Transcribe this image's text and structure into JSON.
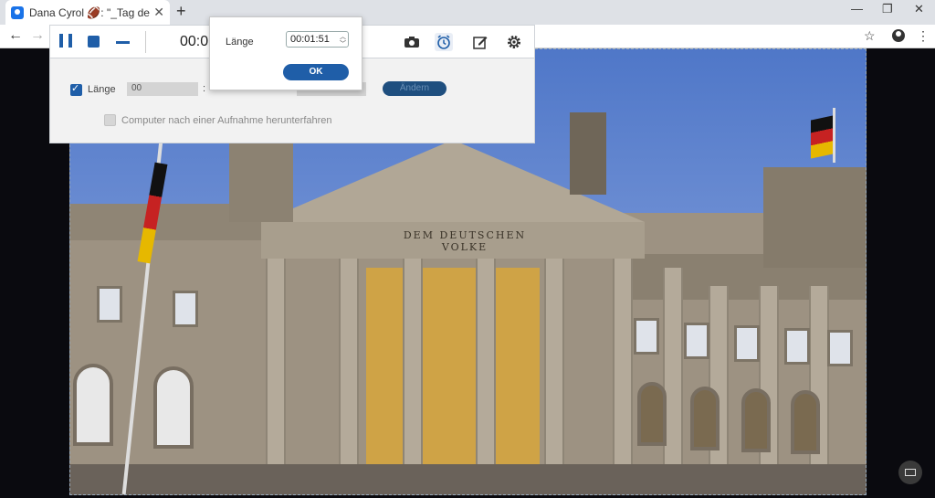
{
  "browser": {
    "tab_title": "Dana Cyrol 🏈: \"_Tag der Deutsche",
    "new_tab_icon": "plus-icon",
    "window_controls": [
      "minimize-icon",
      "restore-icon",
      "close-icon"
    ],
    "nav": [
      "back-arrow-icon",
      "forward-arrow-icon"
    ],
    "right_icons": [
      "star-icon",
      "profile-icon",
      "menu-icon"
    ]
  },
  "recorder": {
    "time": "00:0",
    "icons": [
      "pause-icon",
      "stop-icon",
      "minimize-icon",
      "camera-icon",
      "alarm-clock-icon",
      "edit-icon",
      "gear-icon"
    ],
    "accent_color": "#1f5ea8"
  },
  "panel": {
    "length_label": "Länge",
    "length_checked": true,
    "length_field_value": "00",
    "separator": ":",
    "change_button": "Ändern",
    "shutdown_label": "Computer nach einer Aufnahme herunterfahren",
    "shutdown_checked": false
  },
  "popup": {
    "label": "Länge",
    "value": "00:01:51",
    "ok_label": "OK"
  },
  "video": {
    "inscription": "DEM DEUTSCHEN VOLKE"
  }
}
